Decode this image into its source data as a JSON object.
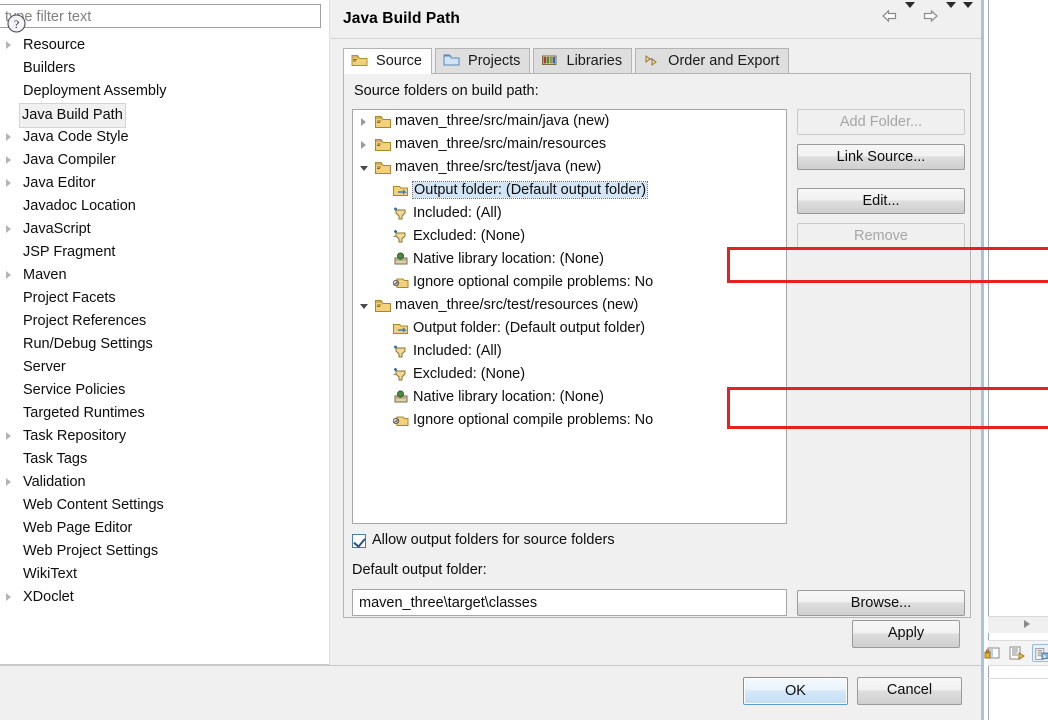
{
  "dialog": {
    "title": "Java Build Path",
    "help_icon": "question-mark-icon"
  },
  "filter": {
    "value": "",
    "placeholder": "type filter text"
  },
  "sidebar": {
    "items": [
      {
        "label": "Resource",
        "expandable": true,
        "selected": false
      },
      {
        "label": "Builders",
        "expandable": false,
        "selected": false
      },
      {
        "label": "Deployment Assembly",
        "expandable": false,
        "selected": false
      },
      {
        "label": "Java Build Path",
        "expandable": false,
        "selected": true
      },
      {
        "label": "Java Code Style",
        "expandable": true,
        "selected": false
      },
      {
        "label": "Java Compiler",
        "expandable": true,
        "selected": false
      },
      {
        "label": "Java Editor",
        "expandable": true,
        "selected": false
      },
      {
        "label": "Javadoc Location",
        "expandable": false,
        "selected": false
      },
      {
        "label": "JavaScript",
        "expandable": true,
        "selected": false
      },
      {
        "label": "JSP Fragment",
        "expandable": false,
        "selected": false
      },
      {
        "label": "Maven",
        "expandable": true,
        "selected": false
      },
      {
        "label": "Project Facets",
        "expandable": false,
        "selected": false
      },
      {
        "label": "Project References",
        "expandable": false,
        "selected": false
      },
      {
        "label": "Run/Debug Settings",
        "expandable": false,
        "selected": false
      },
      {
        "label": "Server",
        "expandable": false,
        "selected": false
      },
      {
        "label": "Service Policies",
        "expandable": false,
        "selected": false
      },
      {
        "label": "Targeted Runtimes",
        "expandable": false,
        "selected": false
      },
      {
        "label": "Task Repository",
        "expandable": true,
        "selected": false
      },
      {
        "label": "Task Tags",
        "expandable": false,
        "selected": false
      },
      {
        "label": "Validation",
        "expandable": true,
        "selected": false
      },
      {
        "label": "Web Content Settings",
        "expandable": false,
        "selected": false
      },
      {
        "label": "Web Page Editor",
        "expandable": false,
        "selected": false
      },
      {
        "label": "Web Project Settings",
        "expandable": false,
        "selected": false
      },
      {
        "label": "WikiText",
        "expandable": false,
        "selected": false
      },
      {
        "label": "XDoclet",
        "expandable": true,
        "selected": false
      }
    ]
  },
  "navbar": {
    "back_icon": "back-arrow-icon",
    "back_dropdown_icon": "chevron-down-icon",
    "forward_icon": "forward-arrow-icon",
    "forward_dropdown_icon": "chevron-down-icon",
    "menu_icon": "chevron-down-icon"
  },
  "tabs": [
    {
      "label": "Source",
      "icon": "source-folder-icon",
      "active": true
    },
    {
      "label": "Projects",
      "icon": "project-icon",
      "active": false
    },
    {
      "label": "Libraries",
      "icon": "library-jar-icon",
      "active": false
    },
    {
      "label": "Order and Export",
      "icon": "order-export-icon",
      "active": false
    }
  ],
  "source_tab": {
    "list_label": "Source folders on build path:",
    "tree": [
      {
        "level": 0,
        "twisty": "collapsed",
        "icon": "source-folder-icon",
        "text": "maven_three/src/main/java (new)",
        "highlighted": false
      },
      {
        "level": 0,
        "twisty": "collapsed",
        "icon": "source-folder-icon",
        "text": "maven_three/src/main/resources",
        "highlighted": false
      },
      {
        "level": 0,
        "twisty": "expanded",
        "icon": "source-folder-icon",
        "text": "maven_three/src/test/java (new)",
        "highlighted": false
      },
      {
        "level": 1,
        "twisty": "none",
        "icon": "output-folder-icon",
        "text": "Output folder: (Default output folder)",
        "highlighted": true
      },
      {
        "level": 1,
        "twisty": "none",
        "icon": "include-filter-icon",
        "text": "Included: (All)",
        "highlighted": false
      },
      {
        "level": 1,
        "twisty": "none",
        "icon": "exclude-filter-icon",
        "text": "Excluded: (None)",
        "highlighted": false
      },
      {
        "level": 1,
        "twisty": "none",
        "icon": "native-library-icon",
        "text": "Native library location: (None)",
        "highlighted": false
      },
      {
        "level": 1,
        "twisty": "none",
        "icon": "ignore-problems-icon",
        "text": "Ignore optional compile problems: No",
        "highlighted": false
      },
      {
        "level": 0,
        "twisty": "expanded",
        "icon": "source-folder-icon",
        "text": "maven_three/src/test/resources (new)",
        "highlighted": false
      },
      {
        "level": 1,
        "twisty": "none",
        "icon": "output-folder-icon",
        "text": "Output folder: (Default output folder)",
        "highlighted": false
      },
      {
        "level": 1,
        "twisty": "none",
        "icon": "include-filter-icon",
        "text": "Included: (All)",
        "highlighted": false
      },
      {
        "level": 1,
        "twisty": "none",
        "icon": "exclude-filter-icon",
        "text": "Excluded: (None)",
        "highlighted": false
      },
      {
        "level": 1,
        "twisty": "none",
        "icon": "native-library-icon",
        "text": "Native library location: (None)",
        "highlighted": false
      },
      {
        "level": 1,
        "twisty": "none",
        "icon": "ignore-problems-icon",
        "text": "Ignore optional compile problems: No",
        "highlighted": false
      }
    ],
    "buttons": {
      "add_folder": {
        "label": "Add Folder...",
        "mnemonic": "d",
        "enabled": false
      },
      "link_source": {
        "label": "Link Source...",
        "mnemonic": "i",
        "enabled": true
      },
      "edit": {
        "label": "Edit...",
        "mnemonic": "E",
        "enabled": true
      },
      "remove": {
        "label": "Remove",
        "mnemonic": "R",
        "enabled": false
      }
    },
    "allow_output_folders": {
      "label": "Allow output folders for source folders",
      "checked": true
    },
    "default_output": {
      "label": "Default output folder:",
      "value": "maven_three\\target\\classes",
      "browse_label": "Browse..."
    }
  },
  "footer": {
    "apply_label": "Apply",
    "ok_label": "OK",
    "cancel_label": "Cancel"
  },
  "annotations": {
    "highlight_color": "#e8201f",
    "box_count": 2
  },
  "background_window": {
    "toolbar_icons": [
      "debug-icon",
      "run-icon",
      "console-icon"
    ],
    "scroll_arrow_icon": "scroll-right-icon"
  },
  "colors": {
    "dialog_bg": "#f0f0f0",
    "list_bg": "#ffffff",
    "selection_bg": "#d3e5f5",
    "accent_border": "#a7c3e0",
    "annotation_red": "#e8201f"
  }
}
